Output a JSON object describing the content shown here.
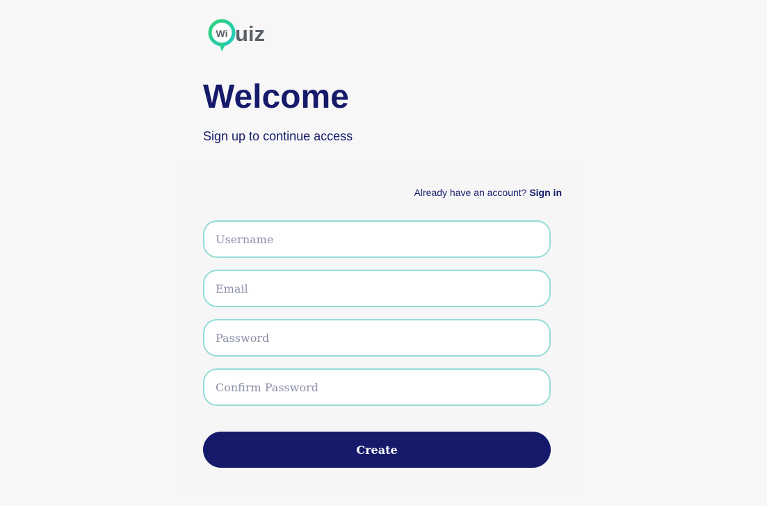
{
  "brand": {
    "logo_badge_text": "Wi",
    "logo_text": "uiz",
    "colors": {
      "logo_gradient_start": "#2fd47a",
      "logo_gradient_end": "#1fc8c0",
      "logo_text": "#5a6168"
    }
  },
  "header": {
    "title": "Welcome",
    "subtitle": "Sign up to continue access"
  },
  "form": {
    "signin_prompt": "Already have an account?",
    "signin_link": "Sign in",
    "fields": {
      "username": {
        "placeholder": "Username",
        "value": ""
      },
      "email": {
        "placeholder": "Email",
        "value": ""
      },
      "password": {
        "placeholder": "Password",
        "value": ""
      },
      "confirm_password": {
        "placeholder": "Confirm Password",
        "value": ""
      }
    },
    "submit_label": "Create"
  },
  "colors": {
    "background": "#f7f7f7",
    "primary": "#151a6b",
    "input_border": "#93dcd6",
    "placeholder": "#8b8fa6"
  }
}
